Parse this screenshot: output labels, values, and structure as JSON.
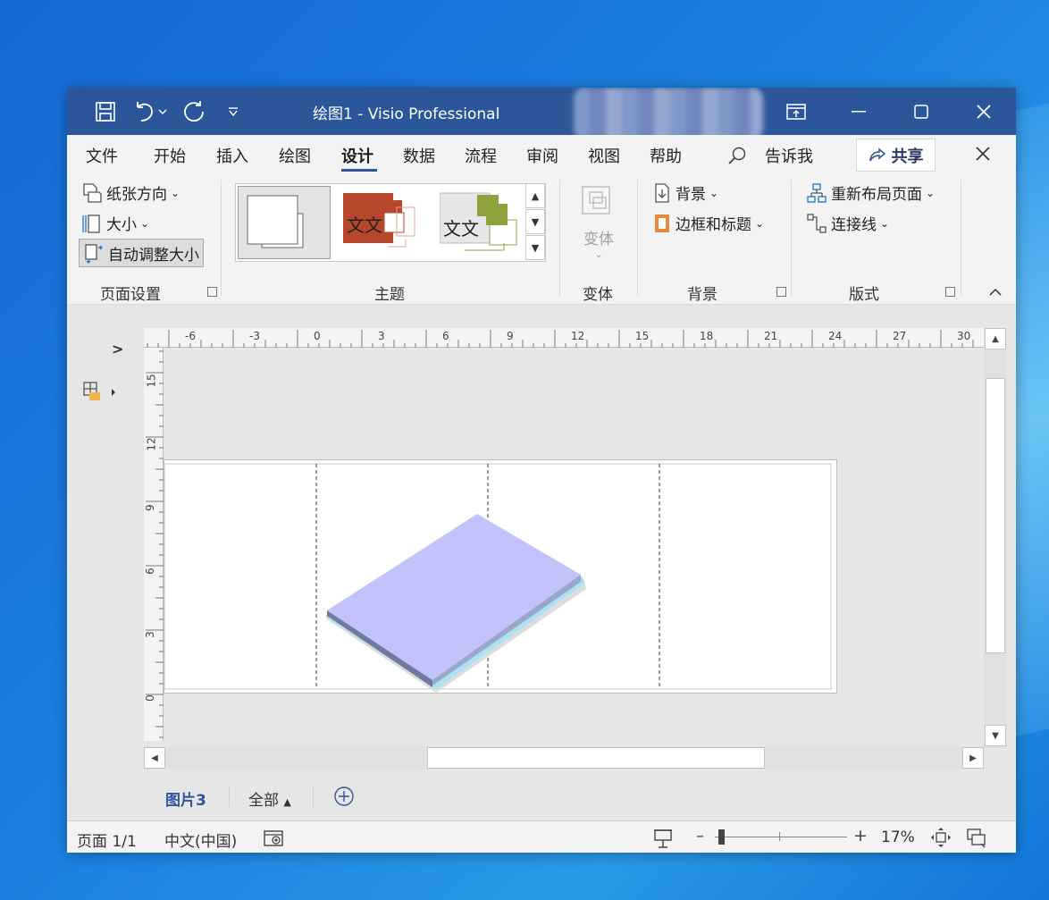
{
  "window": {
    "title": "绘图1  -  Visio Professional"
  },
  "menu": {
    "tabs": [
      "文件",
      "开始",
      "插入",
      "绘图",
      "设计",
      "数据",
      "流程",
      "审阅",
      "视图",
      "帮助"
    ],
    "active": "设计",
    "tell_me": "告诉我",
    "share": "共享"
  },
  "ribbon": {
    "page_setup": {
      "orientation": "纸张方向",
      "size": "大小",
      "auto_size": "自动调整大小",
      "label": "页面设置"
    },
    "themes": {
      "label": "主题",
      "theme_text": "文文",
      "theme_text_2": "文文"
    },
    "variants": {
      "button": "变体",
      "label": "变体"
    },
    "backgrounds": {
      "background": "背景",
      "borders_titles": "边框和标题",
      "label": "背景"
    },
    "layout": {
      "relayout": "重新布局页面",
      "connectors": "连接线",
      "label": "版式"
    }
  },
  "rulers": {
    "horizontal": [
      "-6",
      "-3",
      "0",
      "3",
      "6",
      "9",
      "12",
      "15",
      "18",
      "21",
      "24",
      "27",
      "30"
    ],
    "vertical": [
      "15",
      "12",
      "9",
      "6",
      "3",
      "0"
    ]
  },
  "tabs_bar": {
    "page_tab": "图片3",
    "all_pages": "全部"
  },
  "status": {
    "page": "页面 1/1",
    "language": "中文(中国)",
    "zoom": "17%",
    "zoom_level": 0.17
  },
  "colors": {
    "title_bar": "#2b579a",
    "accent": "#2b579a",
    "shape_top": "#c3c3fb",
    "theme2": "#b7472a",
    "theme3": "#8ea33b"
  }
}
